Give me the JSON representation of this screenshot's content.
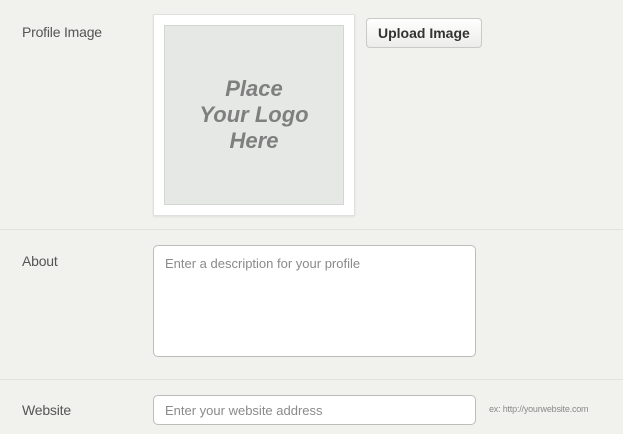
{
  "profile_image": {
    "label": "Profile Image",
    "placeholder_line1": "Place",
    "placeholder_line2": "Your Logo",
    "placeholder_line3": "Here",
    "upload_label": "Upload Image"
  },
  "about": {
    "label": "About",
    "placeholder": "Enter a description for your profile"
  },
  "website": {
    "label": "Website",
    "placeholder": "Enter your website address",
    "hint": "ex: http://yourwebsite.com"
  },
  "colors": {
    "background": "#f1f1ee",
    "placeholder_fill": "#e6e8e6",
    "input_border": "#bdbdb9",
    "text": "#555555"
  }
}
